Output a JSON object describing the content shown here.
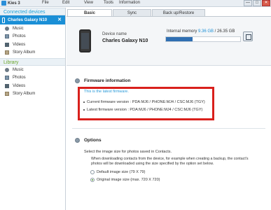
{
  "app": {
    "name": "Kies 3",
    "logo_icon": "kies-logo-icon"
  },
  "menu": [
    "File",
    "Edit",
    "View",
    "Tools",
    "Information"
  ],
  "window_buttons": [
    "—",
    "□",
    "✕"
  ],
  "sidebar": {
    "connected_header": "Connected devices",
    "device": {
      "name": "Charles Galaxy N10",
      "close": "✕"
    },
    "device_items": [
      {
        "label": "Music",
        "icon": "music-icon"
      },
      {
        "label": "Photos",
        "icon": "photo-icon"
      },
      {
        "label": "Videos",
        "icon": "video-icon"
      },
      {
        "label": "Story Album",
        "icon": "story-album-icon"
      }
    ],
    "library_header": "Library",
    "library_items": [
      {
        "label": "Music",
        "icon": "music-icon"
      },
      {
        "label": "Photos",
        "icon": "photo-icon"
      },
      {
        "label": "Videos",
        "icon": "video-icon"
      },
      {
        "label": "Story Album",
        "icon": "story-album-icon"
      }
    ]
  },
  "tabs": [
    {
      "label": "Basic information",
      "active": true
    },
    {
      "label": "Sync",
      "active": false
    },
    {
      "label": "Back up/Restore",
      "active": false
    }
  ],
  "device_panel": {
    "label": "Device name",
    "name": "Charles Galaxy N10",
    "memory_label": "Internal memory",
    "memory_used": "9.36 GB",
    "memory_separator": " / ",
    "memory_total": "26.35 GB",
    "memory_fraction": 0.355
  },
  "firmware": {
    "title": "Firmware information",
    "status": "This is the latest firmware.",
    "current": "Current firmware version : PDA:MJ6 / PHONE:MJ4 / CSC:MJ6 (TGY)",
    "latest": "Latest firmware version : PDA:MJ6 / PHONE:MJ4 / CSC:MJ6 (TGY)"
  },
  "options": {
    "title": "Options",
    "desc": "Select the image size for photos saved in Contacts.",
    "detail": "When downloading contacts from the device, for example when creating a backup, the contact's photos will be downloaded using the size specified by the option set below.",
    "radio_default": "Default image size (79 X 79)",
    "radio_original": "Original image size (max. 720 X 720)"
  },
  "colors": {
    "accent": "#1a8fd6",
    "library": "#6aa52a",
    "highlight": "#d9201c",
    "memory_bar": "#2f6fb2"
  }
}
